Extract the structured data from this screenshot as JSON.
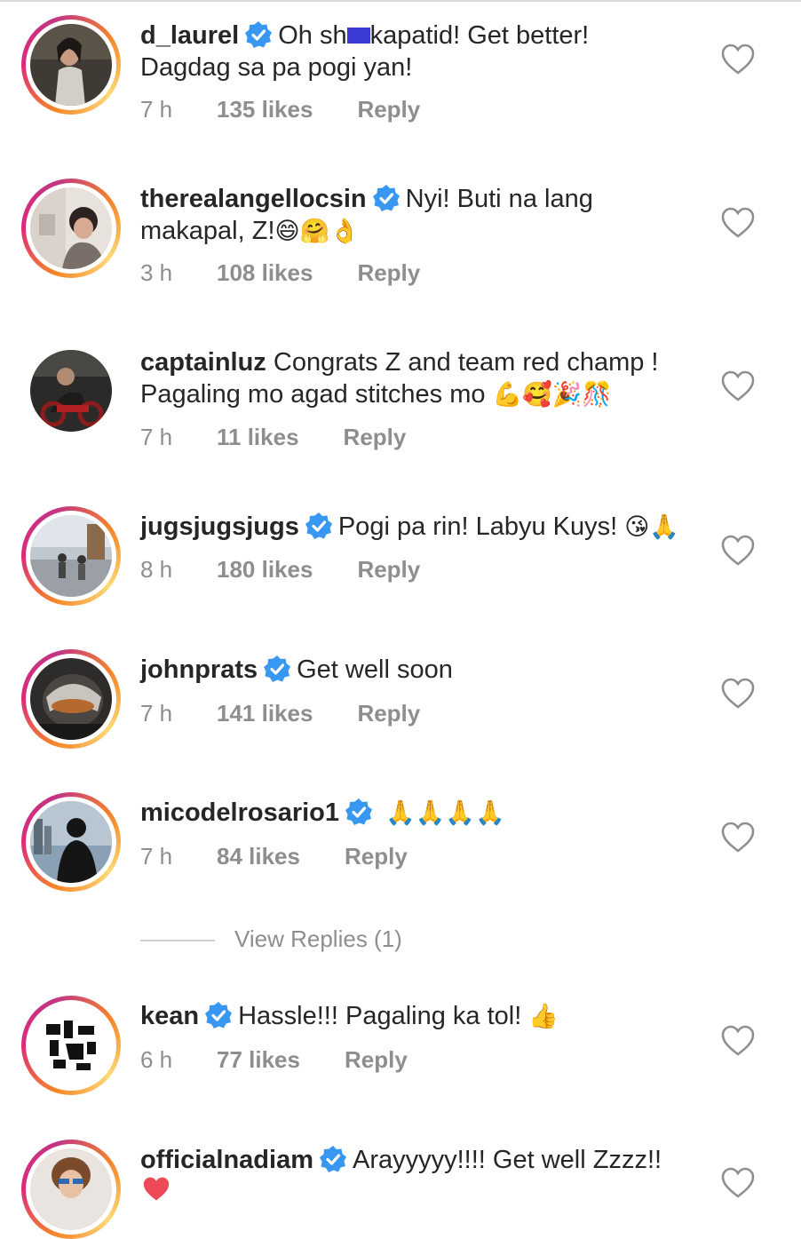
{
  "comments": [
    {
      "username": "d_laurel",
      "text": "Oh sh",
      "text_after": "kapatid! Get better!",
      "line2": "Dagdag sa pa pogi yan!",
      "time": "7 h",
      "likes": "135 likes",
      "reply": "Reply"
    },
    {
      "username": "therealangellocsin",
      "text": "Nyi! Buti na lang",
      "line2": "makapal, Z!",
      "emojis": "😄🤗👌",
      "time": "3 h",
      "likes": "108 likes",
      "reply": "Reply"
    },
    {
      "username": "captainluz",
      "text": "Congrats Z and team red champ !",
      "line2": "Pagaling mo agad stitches mo",
      "emojis": "💪🥰🎉🎊",
      "time": "7 h",
      "likes": "11 likes",
      "reply": "Reply"
    },
    {
      "username": "jugsjugsjugs",
      "text": "Pogi pa rin! Labyu Kuys!",
      "emojis": "😘🙏",
      "time": "8 h",
      "likes": "180 likes",
      "reply": "Reply"
    },
    {
      "username": "johnprats",
      "text": "Get well soon",
      "time": "7 h",
      "likes": "141 likes",
      "reply": "Reply"
    },
    {
      "username": "micodelrosario1",
      "text": "",
      "emojis": "🙏🙏🙏🙏",
      "time": "7 h",
      "likes": "84 likes",
      "reply": "Reply"
    },
    {
      "username": "kean",
      "text": "Hassle!!! Pagaling ka tol!",
      "emojis": "👍",
      "time": "6 h",
      "likes": "77 likes",
      "reply": "Reply"
    },
    {
      "username": "officialnadiam",
      "text": "Arayyyyy!!!! Get well Zzzz!!"
    }
  ],
  "view_replies": "View Replies (1)",
  "colors": {
    "text": "#262626",
    "meta": "#8e8e8e",
    "verified": "#3897f0",
    "heart_filled": "#ed4956"
  },
  "icons": {
    "verified": "verified-badge-icon",
    "like": "heart-outline-icon"
  }
}
